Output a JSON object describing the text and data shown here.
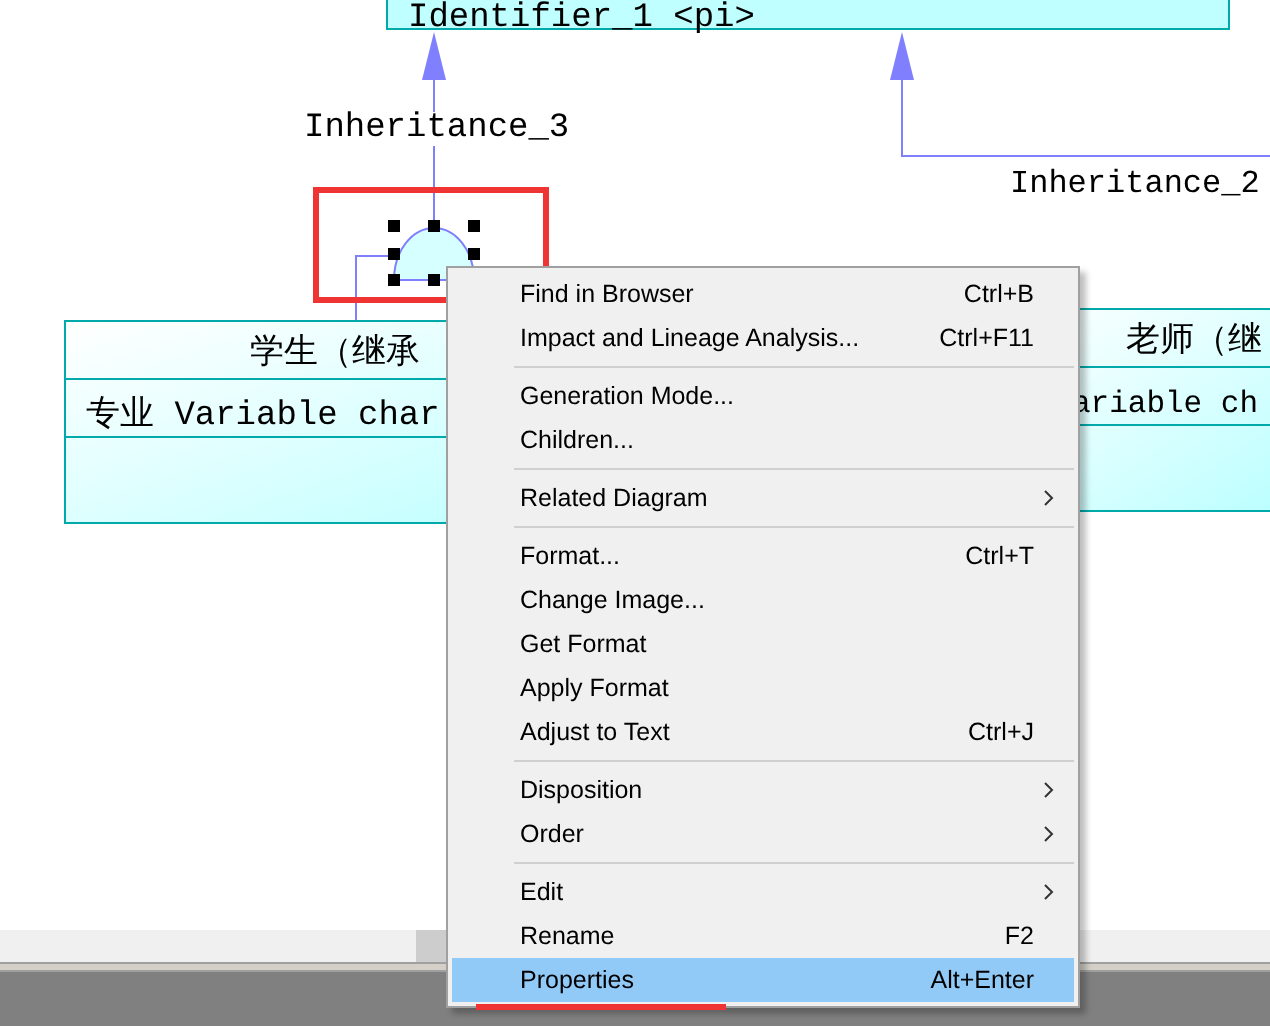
{
  "diagram": {
    "top_class": {
      "title": "Identifier_1 <pi>"
    },
    "links": [
      {
        "label": "Inheritance_3"
      },
      {
        "label": "Inheritance_2"
      }
    ],
    "classes": [
      {
        "title": "学生（继承",
        "attributes": [
          "专业 Variable char"
        ]
      },
      {
        "title": "老师（继",
        "attributes": [
          "ariable ch"
        ]
      }
    ]
  },
  "context_menu": {
    "groups": [
      [
        {
          "label": "Find in Browser",
          "shortcut": "Ctrl+B",
          "has_submenu": false,
          "selected": false
        },
        {
          "label": "Impact and Lineage Analysis...",
          "shortcut": "Ctrl+F11",
          "has_submenu": false,
          "selected": false
        }
      ],
      [
        {
          "label": "Generation Mode...",
          "has_submenu": false,
          "selected": false
        },
        {
          "label": "Children...",
          "has_submenu": false,
          "selected": false
        }
      ],
      [
        {
          "label": "Related Diagram",
          "has_submenu": true,
          "selected": false
        }
      ],
      [
        {
          "label": "Format...",
          "shortcut": "Ctrl+T",
          "has_submenu": false,
          "selected": false
        },
        {
          "label": "Change Image...",
          "has_submenu": false,
          "selected": false
        },
        {
          "label": "Get Format",
          "has_submenu": false,
          "selected": false
        },
        {
          "label": "Apply Format",
          "has_submenu": false,
          "selected": false
        },
        {
          "label": "Adjust to Text",
          "shortcut": "Ctrl+J",
          "has_submenu": false,
          "selected": false
        }
      ],
      [
        {
          "label": "Disposition",
          "has_submenu": true,
          "selected": false
        },
        {
          "label": "Order",
          "has_submenu": true,
          "selected": false
        }
      ],
      [
        {
          "label": "Edit",
          "has_submenu": true,
          "selected": false
        },
        {
          "label": "Rename",
          "shortcut": "F2",
          "has_submenu": false,
          "selected": false
        },
        {
          "label": "Properties",
          "shortcut": "Alt+Enter",
          "has_submenu": false,
          "selected": true
        }
      ]
    ]
  }
}
